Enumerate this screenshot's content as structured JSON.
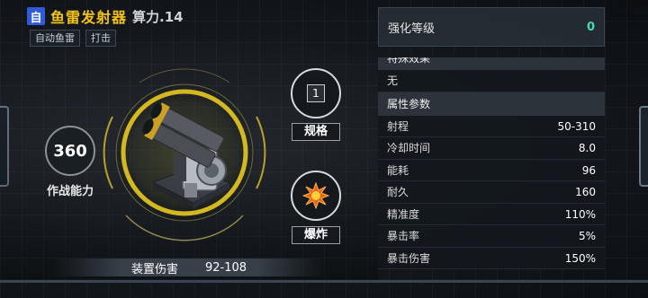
{
  "header": {
    "badge": "自",
    "title": "鱼雷发射器",
    "power_label": "算力",
    "power_value": ".14"
  },
  "tags": [
    "自动鱼雷",
    "打击"
  ],
  "combat": {
    "value": "360",
    "label": "作战能力"
  },
  "spec": {
    "value": "1",
    "label": "规格"
  },
  "blast": {
    "label": "爆炸"
  },
  "damage": {
    "label": "装置伤害",
    "value": "92-108"
  },
  "strength": {
    "label": "强化等级",
    "value": "0"
  },
  "special": {
    "header": "特殊效果",
    "value": "无"
  },
  "attributes": {
    "header": "属性参数",
    "rows": [
      {
        "label": "射程",
        "value": "50-310"
      },
      {
        "label": "冷却时间",
        "value": "8.0"
      },
      {
        "label": "能耗",
        "value": "96"
      },
      {
        "label": "耐久",
        "value": "160"
      },
      {
        "label": "精准度",
        "value": "110%"
      },
      {
        "label": "暴击率",
        "value": "5%"
      },
      {
        "label": "暴击伤害",
        "value": "150%"
      }
    ]
  },
  "colors": {
    "title": "#f2c21b",
    "accent_ring": "#d4b820",
    "strength_value": "#4ad9b0",
    "badge": "#2f5bd8"
  },
  "icons": {
    "weapon": "torpedo-launcher-icon",
    "blast": "explosion-icon"
  }
}
